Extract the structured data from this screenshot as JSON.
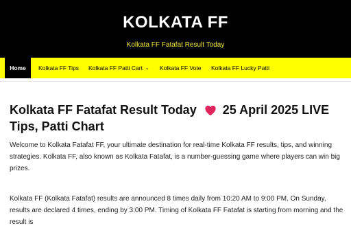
{
  "header": {
    "site_title": "KOLKATA FF",
    "tagline": "Kolkata FF Fatafat Result Today"
  },
  "nav": {
    "items": [
      {
        "label": "Home"
      },
      {
        "label": "Kolkata FF Tips"
      },
      {
        "label": "Kolkata FF Patti Cart"
      },
      {
        "label": "Kolkata FF Vote"
      },
      {
        "label": "Kolkata FF Lucky Patti"
      }
    ]
  },
  "article": {
    "title_part1": "Kolkata FF Fatafat Result Today",
    "title_icon": "heart-icon",
    "title_part2": "25 April 2025 LIVE Tips, Patti Chart",
    "paragraph1": "Welcome to Kolkata Fatafat FF, your ultimate destination for real-time Kolkata FF results, tips, and winning strategies. Kolkata FF, also known as Kolkata Fatafat, is a number-guessing game where players can win big prizes.",
    "paragraph2": "Kolkata FF (Kolkata Fatafat) results are announced 8 times daily from 10:20 AM to 9:00 PM. On Sunday, results are declared 4 times, ending by 3:00 PM. Timing of Kolkata FF Fatafat is starting from morning and the result is"
  },
  "colors": {
    "header_bg": "#000000",
    "nav_bg": "#ffff00",
    "tagline": "#f2ea3a",
    "heart": "#e0245e"
  }
}
